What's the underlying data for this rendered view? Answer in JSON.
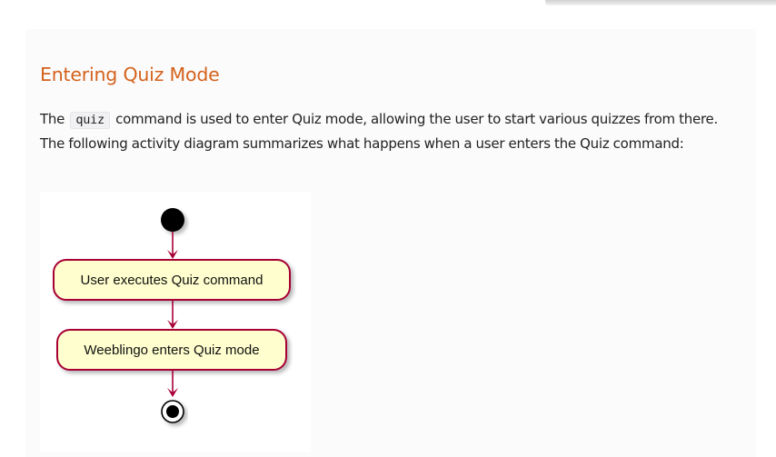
{
  "section": {
    "title": "Entering Quiz Mode",
    "intro_before_code": "The ",
    "intro_code": "quiz",
    "intro_after_code": " command is used to enter Quiz mode, allowing the user to start various quizzes from there. The following activity diagram summarizes what happens when a user enters the Quiz command:"
  },
  "diagram": {
    "activities": [
      {
        "label": "User executes Quiz command"
      },
      {
        "label": "Weeblingo enters Quiz mode"
      }
    ],
    "colors": {
      "activity_fill": "#fefece",
      "activity_border": "#a80036",
      "arrow": "#a80036",
      "start_node": "#000000"
    }
  },
  "theme": {
    "heading_color": "#d4621c",
    "text_color": "#222222"
  }
}
